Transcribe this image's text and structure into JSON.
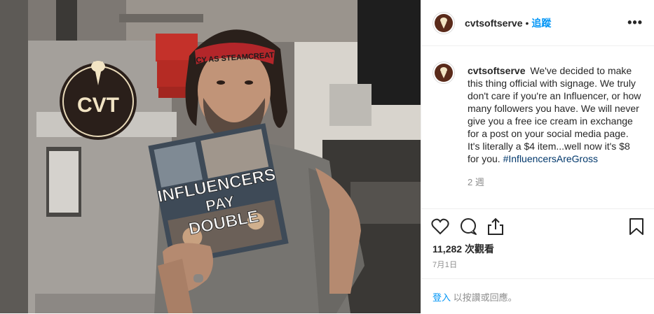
{
  "photo": {
    "sign_line1": "INFLUENCERS",
    "sign_line2": "PAY",
    "sign_line3": "DOUBLE",
    "headband_text": "ICY AS STEAMCREAT",
    "logo_text": "CVT"
  },
  "header": {
    "username": "cvtsoftserve",
    "separator": "•",
    "follow_label": "追蹤",
    "more_label": "•••"
  },
  "caption": {
    "username": "cvtsoftserve",
    "text": "We've decided to make this thing official with signage. We truly don't care if you're an Influencer, or how many followers you have. We will never give you a free ice cream in exchange for a post on your social media page. It's literally a $4 item...well now it's $8 for you. ",
    "hashtag": "#InfluencersAreGross",
    "time_ago": "2 週"
  },
  "engagement": {
    "views": "11,282 次觀看",
    "date": "7月1日"
  },
  "login": {
    "link_label": "登入",
    "suffix": " 以按讚或回應。"
  },
  "icons": [
    "heart-icon",
    "comment-icon",
    "share-icon",
    "bookmark-icon",
    "soft-serve-logo-icon"
  ],
  "colors": {
    "link_blue": "#0095f6",
    "hashtag_blue": "#00376b",
    "muted_gray": "#8e8e8e",
    "border": "#efefef"
  }
}
